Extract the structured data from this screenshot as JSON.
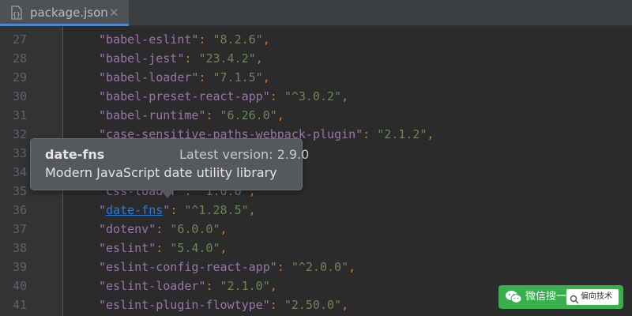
{
  "tab": {
    "title": "package.json",
    "close_glyph": "✕",
    "icon": "json-file-icon"
  },
  "gutter": {
    "line_numbers": [
      "27",
      "28",
      "29",
      "30",
      "31",
      "32",
      "33",
      "34",
      "35",
      "36",
      "37",
      "38",
      "39",
      "40",
      "41"
    ]
  },
  "code": {
    "lines": [
      {
        "key": "\"babel-eslint\"",
        "val": "\"8.2.6\""
      },
      {
        "key": "\"babel-jest\"",
        "val": "\"23.4.2\""
      },
      {
        "key": "\"babel-loader\"",
        "val": "\"7.1.5\""
      },
      {
        "key": "\"babel-preset-react-app\"",
        "val": "\"^3.0.2\""
      },
      {
        "key": "\"babel-runtime\"",
        "val": "\"6.26.0\""
      },
      {
        "key": "\"case-sensitive-paths-webpack-plugin\"",
        "val": "\"2.1.2\""
      },
      {
        "key": "\"css-loader\"",
        "val": "\"1.0.0\""
      },
      {
        "key_prefix": "\"",
        "key_link": "date-fns",
        "key_suffix": "\"",
        "val": "\"^1.28.5\""
      },
      {
        "key": "\"dotenv\"",
        "val": "\"6.0.0\""
      },
      {
        "key": "\"eslint\"",
        "val": "\"5.4.0\""
      },
      {
        "key": "\"eslint-config-react-app\"",
        "val": "\"^2.0.0\""
      },
      {
        "key": "\"eslint-loader\"",
        "val": "\"2.1.0\""
      },
      {
        "key": "\"eslint-plugin-flowtype\"",
        "val": "\"2.50.0\""
      }
    ],
    "colon": ": ",
    "comma": ","
  },
  "tooltip": {
    "package_name": "date-fns",
    "latest_version": "Latest version: 2.9.0",
    "description": "Modern JavaScript date utility library"
  },
  "watermark": {
    "label": "微信搜一搜",
    "search_text": "偏向技术",
    "icon": "wechat-icon",
    "search_icon": "search-icon"
  },
  "colors": {
    "background": "#2b2b2b",
    "gutter": "#313335",
    "key": "#9876aa",
    "string": "#6a8759",
    "punctuation": "#cc7832",
    "link": "#287bde",
    "tooltip_bg": "#55595b",
    "watermark": "#37b04b"
  }
}
